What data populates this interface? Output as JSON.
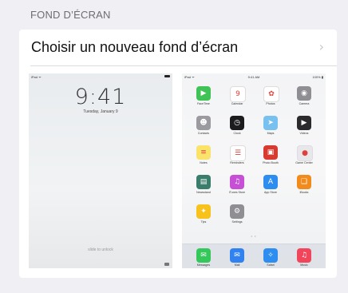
{
  "section": {
    "header": "FOND D’ÉCRAN"
  },
  "row": {
    "label": "Choisir un nouveau fond d’écran",
    "chevron": "›"
  },
  "lock_preview": {
    "status_left": "iPad ᯤ",
    "time": "9:41",
    "date": "Tuesday, January 9",
    "slide_text": "slide to unlock"
  },
  "home_preview": {
    "status_left": "iPad ᯤ",
    "status_center": "9:41 AM",
    "status_right": "100% ▮",
    "page_dots": "• •",
    "apps": [
      {
        "label": "FaceTime",
        "icon": "facetime-icon",
        "color": "#3fc256",
        "glyph": "▶"
      },
      {
        "label": "Calendar",
        "icon": "calendar-icon",
        "color": "#ffffff",
        "glyph": "9"
      },
      {
        "label": "Photos",
        "icon": "photos-icon",
        "color": "#ffffff",
        "glyph": "✿"
      },
      {
        "label": "Camera",
        "icon": "camera-icon",
        "color": "#8e8e93",
        "glyph": "◉"
      },
      {
        "label": "Contacts",
        "icon": "contacts-icon",
        "color": "#9a9a9f",
        "glyph": "☻"
      },
      {
        "label": "Clock",
        "icon": "clock-icon",
        "color": "#1c1c1e",
        "glyph": "◷"
      },
      {
        "label": "Maps",
        "icon": "maps-icon",
        "color": "#78c0f0",
        "glyph": "➤"
      },
      {
        "label": "Videos",
        "icon": "videos-icon",
        "color": "#2b2b2e",
        "glyph": "▶"
      },
      {
        "label": "Notes",
        "icon": "notes-icon",
        "color": "#f9e36b",
        "glyph": "≡"
      },
      {
        "label": "Reminders",
        "icon": "reminders-icon",
        "color": "#ffffff",
        "glyph": "☰"
      },
      {
        "label": "Photo Booth",
        "icon": "photobooth-icon",
        "color": "#d93a2f",
        "glyph": "▣"
      },
      {
        "label": "Game Center",
        "icon": "gamecenter-icon",
        "color": "#e8e8ec",
        "glyph": "●"
      },
      {
        "label": "Newsstand",
        "icon": "newsstand-icon",
        "color": "#3a7d6b",
        "glyph": "▤"
      },
      {
        "label": "iTunes Store",
        "icon": "itunes-icon",
        "color": "#c64fd6",
        "glyph": "♫"
      },
      {
        "label": "App Store",
        "icon": "appstore-icon",
        "color": "#2e8ef0",
        "glyph": "A"
      },
      {
        "label": "iBooks",
        "icon": "ibooks-icon",
        "color": "#f38b1c",
        "glyph": "❑"
      },
      {
        "label": "Tips",
        "icon": "tips-icon",
        "color": "#f6c21b",
        "glyph": "✦"
      },
      {
        "label": "Settings",
        "icon": "settings-icon",
        "color": "#8e8e93",
        "glyph": "⚙"
      }
    ],
    "dock": [
      {
        "label": "Messages",
        "icon": "messages-icon",
        "color": "#34c759",
        "glyph": "✉"
      },
      {
        "label": "Mail",
        "icon": "mail-icon",
        "color": "#2f82f0",
        "glyph": "✉"
      },
      {
        "label": "Safari",
        "icon": "safari-icon",
        "color": "#2e8ef0",
        "glyph": "✧"
      },
      {
        "label": "Music",
        "icon": "music-icon",
        "color": "#f0455b",
        "glyph": "♫"
      }
    ]
  }
}
